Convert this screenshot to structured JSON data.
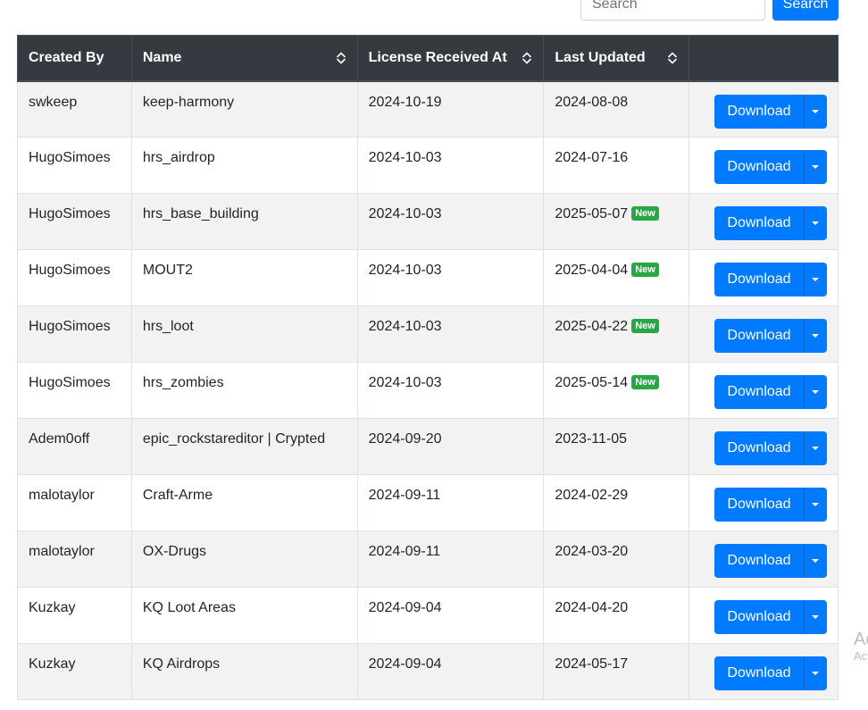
{
  "search": {
    "placeholder": "Search",
    "button_label": "Search"
  },
  "table": {
    "headers": {
      "created_by": "Created By",
      "name": "Name",
      "license_received_at": "License Received At",
      "last_updated": "Last Updated"
    },
    "download_label": "Download",
    "new_badge_label": "New",
    "rows": [
      {
        "created_by": "swkeep",
        "name": "keep-harmony",
        "license_received_at": "2024-10-19",
        "last_updated": "2024-08-08",
        "new": false
      },
      {
        "created_by": "HugoSimoes",
        "name": "hrs_airdrop",
        "license_received_at": "2024-10-03",
        "last_updated": "2024-07-16",
        "new": false
      },
      {
        "created_by": "HugoSimoes",
        "name": "hrs_base_building",
        "license_received_at": "2024-10-03",
        "last_updated": "2025-05-07",
        "new": true
      },
      {
        "created_by": "HugoSimoes",
        "name": "MOUT2",
        "license_received_at": "2024-10-03",
        "last_updated": "2025-04-04",
        "new": true
      },
      {
        "created_by": "HugoSimoes",
        "name": "hrs_loot",
        "license_received_at": "2024-10-03",
        "last_updated": "2025-04-22",
        "new": true
      },
      {
        "created_by": "HugoSimoes",
        "name": "hrs_zombies",
        "license_received_at": "2024-10-03",
        "last_updated": "2025-05-14",
        "new": true
      },
      {
        "created_by": "Adem0off",
        "name": "epic_rockstareditor | Crypted",
        "license_received_at": "2024-09-20",
        "last_updated": "2023-11-05",
        "new": false
      },
      {
        "created_by": "malotaylor",
        "name": "Craft-Arme",
        "license_received_at": "2024-09-11",
        "last_updated": "2024-02-29",
        "new": false
      },
      {
        "created_by": "malotaylor",
        "name": "OX-Drugs",
        "license_received_at": "2024-09-11",
        "last_updated": "2024-03-20",
        "new": false
      },
      {
        "created_by": "Kuzkay",
        "name": "KQ Loot Areas",
        "license_received_at": "2024-09-04",
        "last_updated": "2024-04-20",
        "new": false
      },
      {
        "created_by": "Kuzkay",
        "name": "KQ Airdrops",
        "license_received_at": "2024-09-04",
        "last_updated": "2024-05-17",
        "new": false
      }
    ]
  },
  "watermark": {
    "line1": "Ac",
    "line2": "Ac"
  },
  "colors": {
    "header_bg": "#343a40",
    "primary": "#007bff",
    "success": "#28a745",
    "stripe": "#f2f2f2"
  },
  "icons": {
    "sort": "sort-icon",
    "dropdown": "caret-down-icon"
  }
}
